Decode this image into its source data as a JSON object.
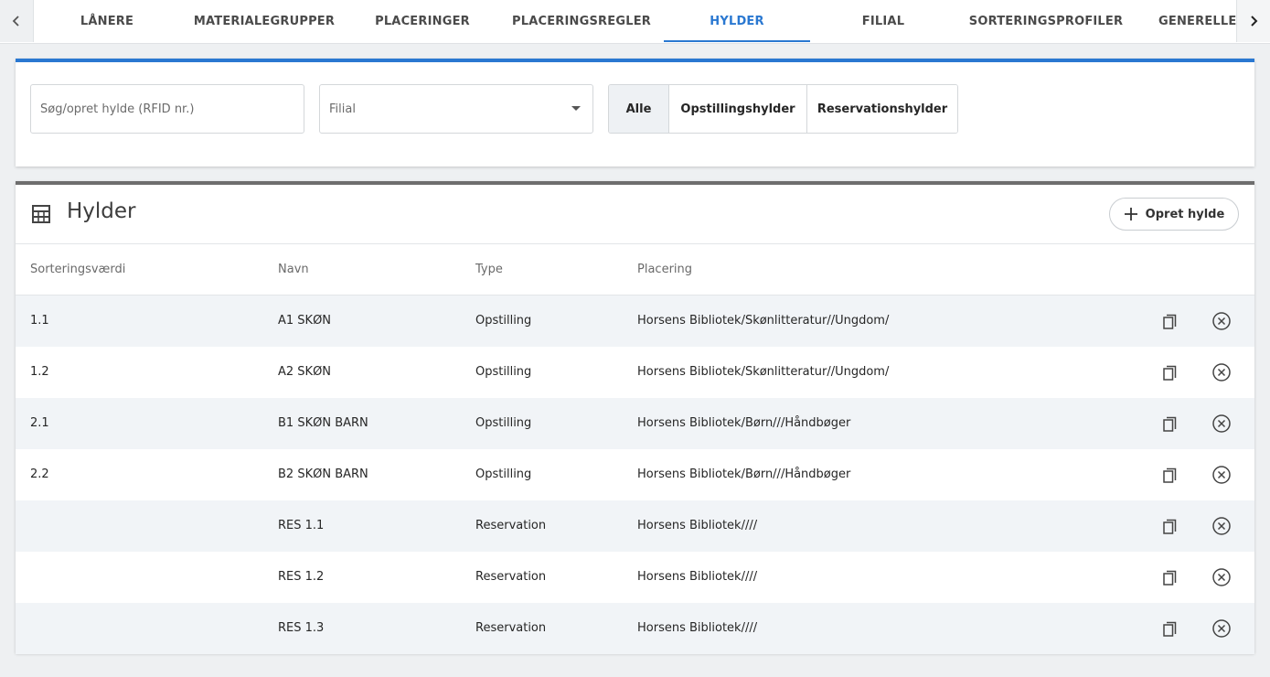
{
  "tabs": {
    "items": [
      {
        "label": "LÅNERE"
      },
      {
        "label": "MATERIALEGRUPPER"
      },
      {
        "label": "PLACERINGER"
      },
      {
        "label": "PLACERINGSREGLER"
      },
      {
        "label": "HYLDER",
        "active": true
      },
      {
        "label": "FILIAL"
      },
      {
        "label": "SORTERINGSPROFILER"
      },
      {
        "label": "GENERELLE INDSTILLINGER"
      }
    ],
    "prev_icon": "chevron-left-icon",
    "next_icon": "chevron-right-icon"
  },
  "filters": {
    "search_placeholder": "Søg/opret hylde (RFID nr.)",
    "search_value": "",
    "branch_placeholder": "Filial",
    "segments": [
      {
        "label": "Alle",
        "active": true
      },
      {
        "label": "Opstillingshylder"
      },
      {
        "label": "Reservationshylder"
      }
    ]
  },
  "shelves": {
    "title": "Hylder",
    "title_icon": "shelf-icon",
    "create_label": "Opret hylde",
    "columns": [
      "Sorteringsværdi",
      "Navn",
      "Type",
      "Placering"
    ],
    "rows": [
      {
        "sort": "1.1",
        "name": "A1 SKØN",
        "type": "Opstilling",
        "location": "Horsens Bibliotek/Skønlitteratur//Ungdom/"
      },
      {
        "sort": "1.2",
        "name": "A2 SKØN",
        "type": "Opstilling",
        "location": "Horsens Bibliotek/Skønlitteratur//Ungdom/"
      },
      {
        "sort": "2.1",
        "name": "B1 SKØN BARN",
        "type": "Opstilling",
        "location": "Horsens Bibliotek/Børn///Håndbøger"
      },
      {
        "sort": "2.2",
        "name": "B2 SKØN BARN",
        "type": "Opstilling",
        "location": "Horsens Bibliotek/Børn///Håndbøger"
      },
      {
        "sort": "",
        "name": "RES 1.1",
        "type": "Reservation",
        "location": "Horsens Bibliotek////"
      },
      {
        "sort": "",
        "name": "RES 1.2",
        "type": "Reservation",
        "location": "Horsens Bibliotek////"
      },
      {
        "sort": "",
        "name": "RES 1.3",
        "type": "Reservation",
        "location": "Horsens Bibliotek////"
      }
    ]
  },
  "colors": {
    "accent": "#2a78d1",
    "card_border_dark": "#6e6e6e",
    "row_stripe": "#f1f4f7",
    "background": "#eef0f2"
  }
}
